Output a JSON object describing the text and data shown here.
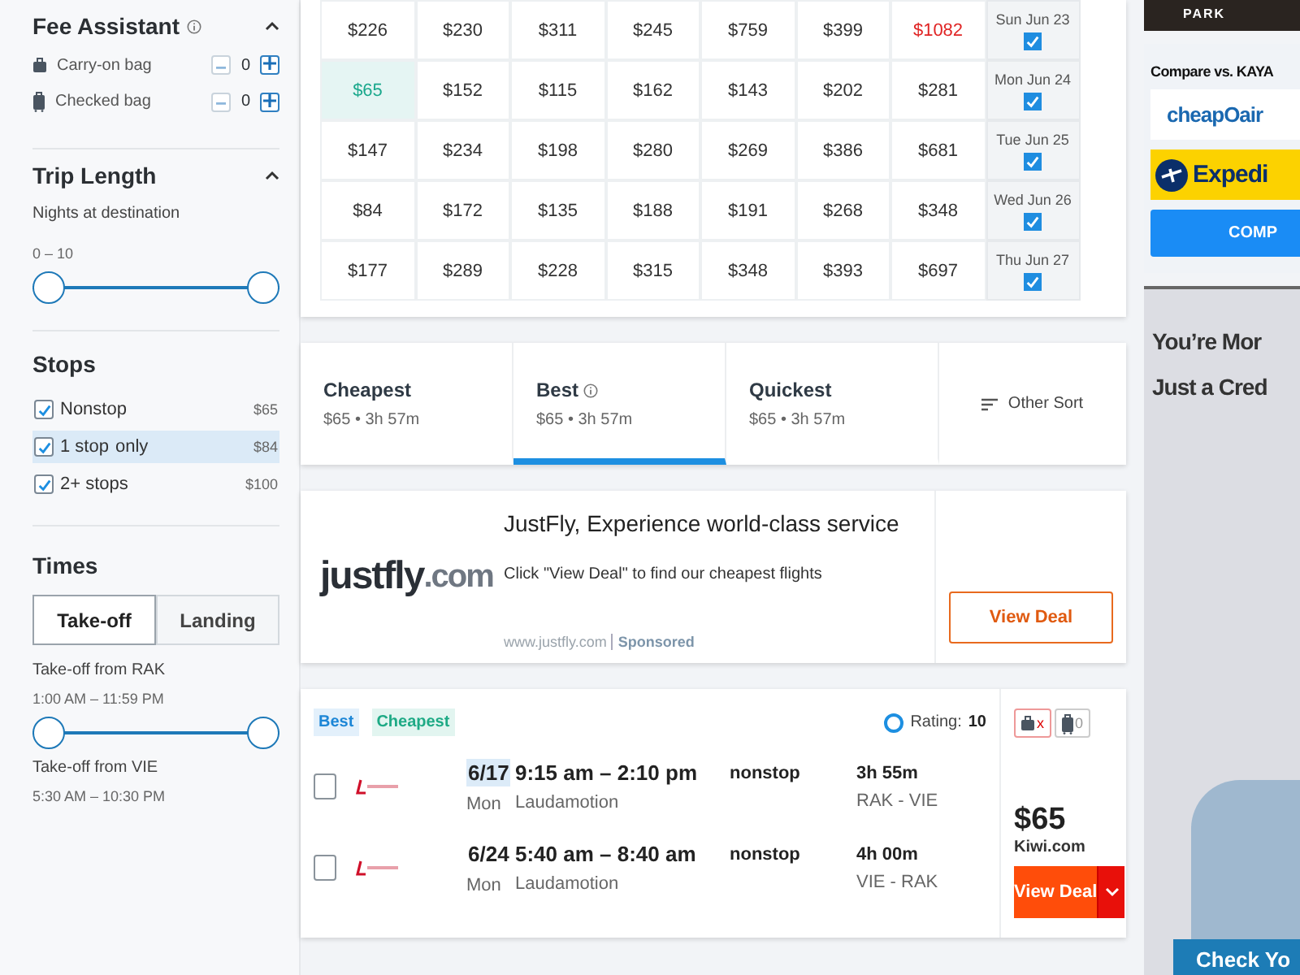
{
  "fee_assistant": {
    "title": "Fee Assistant",
    "expanded": true,
    "bags": [
      {
        "kind": "carryon",
        "label": "Carry-on bag",
        "count": "0"
      },
      {
        "kind": "checked",
        "label": "Checked bag",
        "count": "0"
      }
    ]
  },
  "trip_length": {
    "title": "Trip Length",
    "expanded": true,
    "label": "Nights at destination",
    "range": "0 – 10",
    "level": 1
  },
  "stops": {
    "title": "Stops",
    "options": [
      {
        "label": "Nonstop",
        "price": "$65",
        "checked": true,
        "selected": false
      },
      {
        "label": "1 stop",
        "extra": "only",
        "price": "$84",
        "checked": true,
        "selected": true
      },
      {
        "label": "2+ stops",
        "price": "$100",
        "checked": true,
        "selected": false
      }
    ]
  },
  "times": {
    "title": "Times",
    "tabs": [
      {
        "label": "Take-off",
        "selected": true
      },
      {
        "label": "Landing",
        "selected": false
      }
    ],
    "sliders": [
      {
        "label": "Take-off from RAK",
        "range": "1:00 AM – 11:59 PM",
        "level": 1
      },
      {
        "label": "Take-off from VIE",
        "range": "5:30 AM – 10:30 PM"
      }
    ]
  },
  "price_matrix": {
    "rows": [
      {
        "date": "Sun Jun 23",
        "checked": true,
        "cells": [
          {
            "text": "$226",
            "kind": "normal"
          },
          {
            "text": "$230",
            "kind": "normal"
          },
          {
            "text": "$311",
            "kind": "normal"
          },
          {
            "text": "$245",
            "kind": "normal"
          },
          {
            "text": "$759",
            "kind": "normal"
          },
          {
            "text": "$399",
            "kind": "normal"
          },
          {
            "text": "$1082",
            "kind": "highest"
          }
        ]
      },
      {
        "date": "Mon Jun 24",
        "checked": true,
        "cells": [
          {
            "text": "$65",
            "kind": "lowest"
          },
          {
            "text": "$152",
            "kind": "normal"
          },
          {
            "text": "$115",
            "kind": "normal"
          },
          {
            "text": "$162",
            "kind": "normal"
          },
          {
            "text": "$143",
            "kind": "normal"
          },
          {
            "text": "$202",
            "kind": "normal"
          },
          {
            "text": "$281",
            "kind": "normal"
          }
        ]
      },
      {
        "date": "Tue Jun 25",
        "checked": true,
        "cells": [
          {
            "text": "$147",
            "kind": "normal"
          },
          {
            "text": "$234",
            "kind": "normal"
          },
          {
            "text": "$198",
            "kind": "normal"
          },
          {
            "text": "$280",
            "kind": "normal"
          },
          {
            "text": "$269",
            "kind": "normal"
          },
          {
            "text": "$386",
            "kind": "normal"
          },
          {
            "text": "$681",
            "kind": "normal"
          }
        ]
      },
      {
        "date": "Wed Jun 26",
        "checked": true,
        "cells": [
          {
            "text": "$84",
            "kind": "normal"
          },
          {
            "text": "$172",
            "kind": "normal"
          },
          {
            "text": "$135",
            "kind": "normal"
          },
          {
            "text": "$188",
            "kind": "normal"
          },
          {
            "text": "$191",
            "kind": "normal"
          },
          {
            "text": "$268",
            "kind": "normal"
          },
          {
            "text": "$348",
            "kind": "normal"
          }
        ]
      },
      {
        "date": "Thu Jun 27",
        "checked": true,
        "cells": [
          {
            "text": "$177",
            "kind": "normal"
          },
          {
            "text": "$289",
            "kind": "normal"
          },
          {
            "text": "$228",
            "kind": "normal"
          },
          {
            "text": "$315",
            "kind": "normal"
          },
          {
            "text": "$348",
            "kind": "normal"
          },
          {
            "text": "$393",
            "kind": "normal"
          },
          {
            "text": "$697",
            "kind": "normal"
          }
        ]
      }
    ]
  },
  "sort_tabs": {
    "tabs": [
      {
        "label": "Cheapest",
        "summary": "$65 • 3h 57m",
        "selected": false,
        "info": false
      },
      {
        "label": "Best",
        "summary": "$65 • 3h 57m",
        "selected": true,
        "info": true
      },
      {
        "label": "Quickest",
        "summary": "$65 • 3h 57m",
        "selected": false,
        "info": false
      }
    ],
    "other_sort": "Other Sort"
  },
  "ad": {
    "logo_parts": [
      "justfly",
      ".com"
    ],
    "title": "JustFly, Experience world-class service",
    "description": "Click \"View Deal\" to find our cheapest flights",
    "url": "www.justfly.com",
    "sponsored": "Sponsored",
    "button": "View Deal"
  },
  "result": {
    "tags": [
      {
        "label": "Best",
        "kind": "best"
      },
      {
        "label": "Cheapest",
        "kind": "cheapest"
      }
    ],
    "rating_label": "Rating:",
    "rating": "10",
    "bag_badges": [
      {
        "kind": "carryon",
        "text": "x"
      },
      {
        "kind": "checked",
        "text": "0"
      }
    ],
    "legs": [
      {
        "checked": false,
        "date": "6/17",
        "date_selected": true,
        "day": "Mon",
        "times": "9:15 am – 2:10 pm",
        "airline": "Laudamotion",
        "stops": "nonstop",
        "duration": "3h 55m",
        "route": "RAK - VIE"
      },
      {
        "checked": false,
        "date": "6/24",
        "date_selected": false,
        "day": "Mon",
        "times": "5:40 am – 8:40 am",
        "airline": "Laudamotion",
        "stops": "nonstop",
        "duration": "4h 00m",
        "route": "VIE - RAK"
      }
    ],
    "price": "$65",
    "provider": "Kiwi.com",
    "button": "View Deal"
  },
  "right_rail": {
    "banner": "PARK",
    "compare_title": "Compare vs. KAYA",
    "compare_sites": [
      {
        "kind": "cheapoair",
        "name": "cheapOair"
      },
      {
        "kind": "expedia",
        "name": "Expedi"
      }
    ],
    "compare_button": "COMP",
    "promo_lines": [
      "You’re Mor",
      "Just a Cred"
    ],
    "promo_button": "Check Yo"
  }
}
